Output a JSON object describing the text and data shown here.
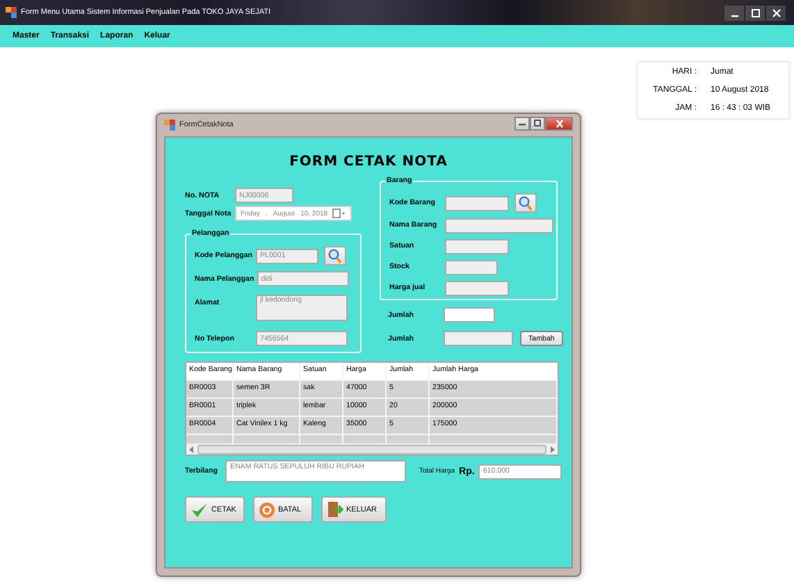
{
  "window": {
    "title": "Form Menu Utama Sistem Informasi Penjualan Pada TOKO  JAYA SEJATI"
  },
  "menu": [
    "Master",
    "Transaksi",
    "Laporan",
    "Keluar"
  ],
  "info": [
    {
      "label": "HARI :",
      "value": "Jumat"
    },
    {
      "label": "TANGGAL :",
      "value": "10 August 2018"
    },
    {
      "label": "JAM :",
      "value": "16 : 43 : 03  WIB"
    }
  ],
  "dialog": {
    "title": "FormCetakNota",
    "heading": "FORM CETAK NOTA",
    "nota": {
      "label": "No. NOTA",
      "value": "NJ00006",
      "readonly": true
    },
    "tanggal": {
      "label": "Tanggal Nota",
      "value": "Friday   ,   August   10, 2018"
    },
    "pelanggan": {
      "label": "Pelanggan",
      "fields": [
        {
          "label": "Kode Pelanggan",
          "value": "PL0001",
          "readonly": true,
          "search": true,
          "kind": "line"
        },
        {
          "label": "Nama Pelanggan",
          "value": "didi",
          "readonly": true,
          "search": false,
          "kind": "line"
        },
        {
          "label": "Alamat",
          "value": "jl kedondong",
          "readonly": true,
          "search": false,
          "kind": "multiline"
        },
        {
          "label": "No Telepon",
          "value": "7456564",
          "readonly": true,
          "search": false,
          "kind": "line"
        }
      ]
    },
    "barang": {
      "label": "Barang",
      "fields": [
        {
          "label": "Kode Barang",
          "readonly": true,
          "search": true
        },
        {
          "label": "Nama Barang",
          "readonly": true,
          "search": false
        },
        {
          "label": "Satuan",
          "readonly": true,
          "search": false
        },
        {
          "label": "Stock",
          "readonly": true,
          "search": false
        },
        {
          "label": "Harga jual",
          "readonly": true,
          "search": false
        }
      ]
    },
    "jumlah": [
      {
        "label": "Jumlah",
        "readonly": false
      },
      {
        "label": "Jumlah",
        "readonly": true,
        "button": "Tambah"
      }
    ],
    "table": {
      "columns": [
        "Kode Barang",
        "Nama Barang",
        "Satuan",
        "Harga",
        "Jumlah",
        "Jumlah Harga"
      ],
      "rows": [
        [
          "BR0003",
          "semen 3R",
          "sak",
          "47000",
          "5",
          "235000"
        ],
        [
          "BR0001",
          "triplek",
          "lembar",
          "10000",
          "20",
          "200000"
        ],
        [
          "BR0004",
          "Cat Vinilex 1 kg",
          "Kaleng",
          "35000",
          "5",
          "175000"
        ]
      ]
    },
    "terbilang": {
      "label": "Terbilang",
      "value": "ENAM RATUS SEPULUH RIBU RUPIAH"
    },
    "total": {
      "label": "Total Harga",
      "currency": "Rp.",
      "value": "610,000"
    },
    "buttons": [
      {
        "label": "CETAK",
        "kind": "check"
      },
      {
        "label": "BATAL",
        "kind": "cancel"
      },
      {
        "label": "KELUAR",
        "kind": "exit"
      }
    ]
  }
}
